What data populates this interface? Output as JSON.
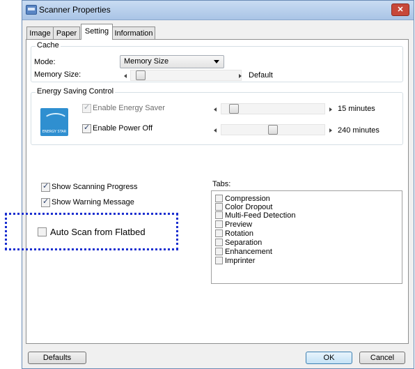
{
  "window": {
    "title": "Scanner Properties",
    "close_label": "✕"
  },
  "tabs": [
    {
      "label": "Image"
    },
    {
      "label": "Paper"
    },
    {
      "label": "Setting"
    },
    {
      "label": "Information"
    }
  ],
  "cache": {
    "group_title": "Cache",
    "mode_label": "Mode:",
    "mode_value": "Memory Size",
    "memory_size_label": "Memory Size:",
    "memory_size_value": "Default",
    "memory_slider_level": 0.05
  },
  "energy": {
    "group_title": "Energy Saving Control",
    "logo_text": "ENERGY STAR",
    "energy_saver_label": "Enable Energy Saver",
    "energy_saver_checked": true,
    "energy_saver_value": "15 minutes",
    "energy_saver_level": 0.08,
    "power_off_label": "Enable Power Off",
    "power_off_checked": true,
    "power_off_value": "240 minutes",
    "power_off_level": 0.5
  },
  "options": {
    "show_progress_label": "Show Scanning Progress",
    "show_progress_checked": true,
    "show_warning_label": "Show Warning Message",
    "show_warning_checked": true,
    "auto_scan_label": "Auto Scan from Flatbed",
    "auto_scan_checked": false
  },
  "tabs_list": {
    "label": "Tabs:",
    "items": [
      "Compression",
      "Color Dropout",
      "Multi-Feed Detection",
      "Preview",
      "Rotation",
      "Separation",
      "Enhancement",
      "Imprinter"
    ]
  },
  "buttons": {
    "defaults": "Defaults",
    "ok": "OK",
    "cancel": "Cancel"
  },
  "colors": {
    "highlight": "#1b2fd0",
    "titlebar": "#c9dcf2",
    "energy_logo": "#2f8fd0"
  }
}
